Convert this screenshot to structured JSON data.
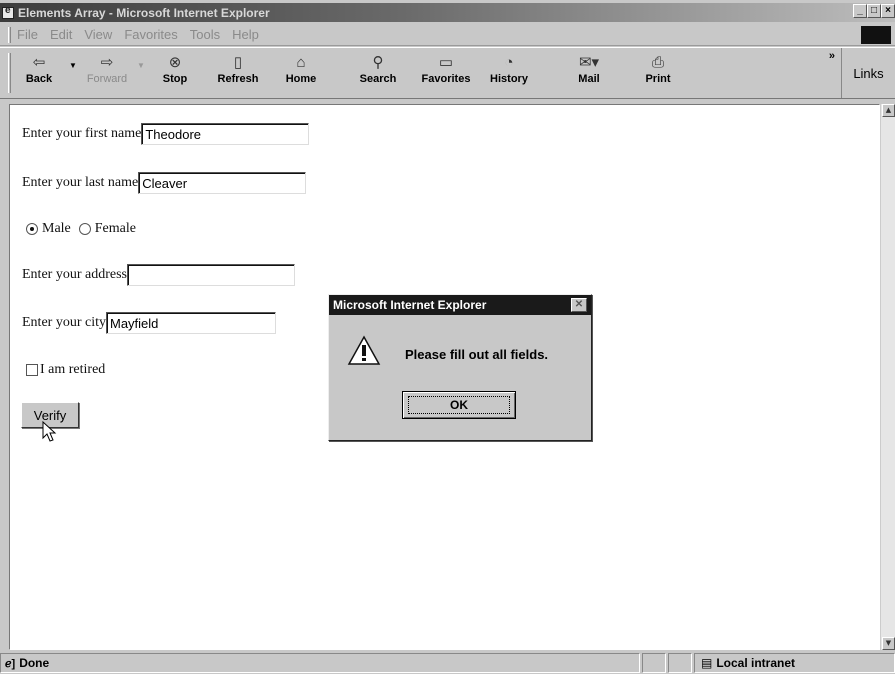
{
  "window": {
    "title": "Elements Array - Microsoft Internet Explorer",
    "controls": [
      "_",
      "□",
      "×"
    ]
  },
  "menu": [
    "File",
    "Edit",
    "View",
    "Favorites",
    "Tools",
    "Help"
  ],
  "toolbar": {
    "buttons": [
      {
        "label": "Back",
        "icon": "back-arrow-icon"
      },
      {
        "label": "Forward",
        "icon": "forward-arrow-icon"
      },
      {
        "label": "Stop",
        "icon": "stop-icon"
      },
      {
        "label": "Refresh",
        "icon": "refresh-icon"
      },
      {
        "label": "Home",
        "icon": "home-icon"
      },
      {
        "label": "Search",
        "icon": "search-icon"
      },
      {
        "label": "Favorites",
        "icon": "favorites-icon"
      },
      {
        "label": "History",
        "icon": "history-icon"
      },
      {
        "label": "Mail",
        "icon": "mail-icon"
      },
      {
        "label": "Print",
        "icon": "print-icon"
      }
    ],
    "chevron": "»",
    "links_label": "Links"
  },
  "form": {
    "first_name_label": "Enter your first name",
    "first_name_value": "Theodore",
    "last_name_label": "Enter your last name",
    "last_name_value": "Cleaver",
    "gender_options": [
      {
        "label": "Male",
        "checked": true
      },
      {
        "label": "Female",
        "checked": false
      }
    ],
    "address_label": "Enter your address",
    "address_value": "",
    "city_label": "Enter your city",
    "city_value": "Mayfield",
    "retired_label": "I am retired",
    "retired_checked": false,
    "verify_label": "Verify"
  },
  "dialog": {
    "title": "Microsoft Internet Explorer",
    "message": "Please fill out all fields.",
    "ok_label": "OK"
  },
  "status": {
    "text": "Done",
    "zone": "Local intranet"
  }
}
